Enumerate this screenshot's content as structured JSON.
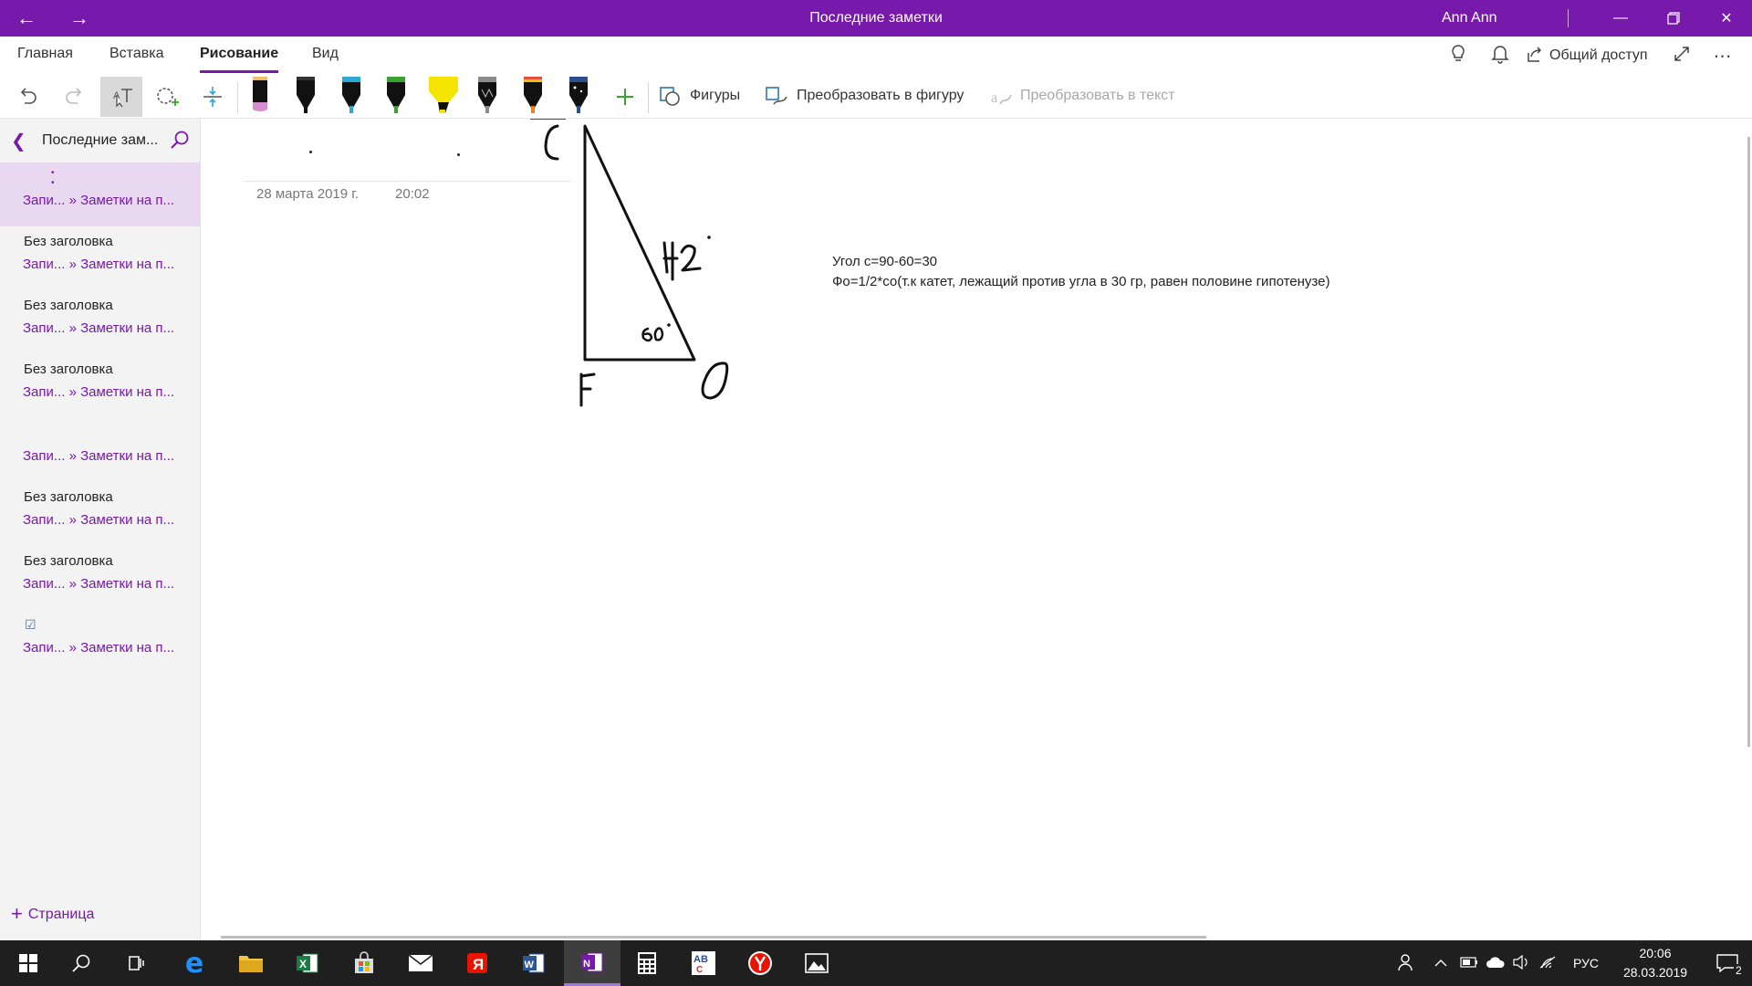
{
  "window": {
    "title": "Последние заметки",
    "user": "Ann Ann"
  },
  "ribbon": {
    "tabs": [
      {
        "label": "Главная"
      },
      {
        "label": "Вставка"
      },
      {
        "label": "Рисование"
      },
      {
        "label": "Вид"
      }
    ],
    "active_tab": "Рисование",
    "share_label": "Общий доступ"
  },
  "toolbar": {
    "shapes_label": "Фигуры",
    "ink_to_shape_label": "Преобразовать в фигуру",
    "ink_to_text_label": "Преобразовать в текст",
    "pens": [
      {
        "icon": "pen-black-pink-icon",
        "color": "#000000",
        "accent": "#d58fd1"
      },
      {
        "icon": "pen-black-icon",
        "color": "#000000"
      },
      {
        "icon": "pen-cyan-icon",
        "color": "#2ea8d6"
      },
      {
        "icon": "pen-green-icon",
        "color": "#3aa22f"
      },
      {
        "icon": "highlighter-yellow-icon",
        "color": "#f5e400"
      },
      {
        "icon": "pen-gray-icon",
        "color": "#8c8c8c"
      },
      {
        "icon": "pen-rainbow-icon",
        "color": "#e67e22"
      },
      {
        "icon": "pen-galaxy-icon",
        "color": "#2c4f8c"
      }
    ]
  },
  "sidebar": {
    "title": "Последние зам...",
    "add_page_label": "Страница",
    "pages": [
      {
        "title": "",
        "path": "Запи... » Заметки на п..."
      },
      {
        "title": "Без заголовка",
        "path": "Запи... » Заметки на п..."
      },
      {
        "title": "Без заголовка",
        "path": "Запи... » Заметки на п..."
      },
      {
        "title": "Без заголовка",
        "path": "Запи... » Заметки на п..."
      },
      {
        "title": "",
        "path": "Запи... » Заметки на п..."
      },
      {
        "title": "Без заголовка",
        "path": "Запи... » Заметки на п..."
      },
      {
        "title": "Без заголовка",
        "path": "Запи... » Заметки на п..."
      },
      {
        "title": "",
        "path": "Запи... » Заметки на п..."
      }
    ]
  },
  "page": {
    "date": "28 марта 2019 г.",
    "time": "20:02",
    "note_line1": "Угол с=90-60=30",
    "note_line2": "Фо=1/2*со(т.к катет, лежащий против угла в 30 гр, равен половине гипотенузе)"
  },
  "ink": {
    "labels": [
      "C",
      "42",
      "60",
      "F",
      "O"
    ]
  },
  "taskbar": {
    "language": "РУС",
    "time": "20:06",
    "date": "28.03.2019",
    "notifications": "2"
  }
}
